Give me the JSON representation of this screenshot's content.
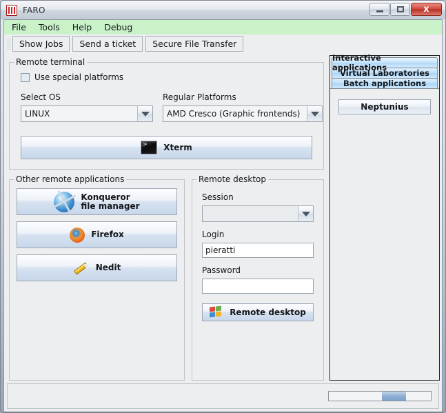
{
  "window": {
    "title": "FARO",
    "title_suffix": "",
    "icon": "faro-app-icon",
    "minimize_label": "",
    "maximize_label": "",
    "close_label": "x"
  },
  "menubar": {
    "items": [
      {
        "label": "File"
      },
      {
        "label": "Tools"
      },
      {
        "label": "Help"
      },
      {
        "label": "Debug"
      }
    ]
  },
  "toolbar": {
    "buttons": [
      {
        "label": "Show Jobs"
      },
      {
        "label": "Send a ticket"
      },
      {
        "label": "Secure File Transfer"
      }
    ]
  },
  "remote_terminal": {
    "title": "Remote terminal",
    "special_platforms": {
      "label": "Use special platforms",
      "checked": false
    },
    "select_os": {
      "label": "Select OS",
      "value": "LINUX"
    },
    "regular_platforms": {
      "label": "Regular Platforms",
      "value": "AMD Cresco (Graphic frontends)"
    },
    "xterm_button": {
      "label": "Xterm",
      "icon": "terminal-icon"
    }
  },
  "other_apps": {
    "title": "Other remote applications",
    "buttons": [
      {
        "label": "Konqueror\nfile manager",
        "line1": "Konqueror",
        "line2": "file manager",
        "icon": "konqueror-icon"
      },
      {
        "label": "Firefox",
        "line1": "Firefox",
        "line2": "",
        "icon": "firefox-icon"
      },
      {
        "label": "Nedit",
        "line1": "Nedit",
        "line2": "",
        "icon": "nedit-icon"
      }
    ]
  },
  "remote_desktop": {
    "title": "Remote desktop",
    "session": {
      "label": "Session",
      "value": ""
    },
    "login": {
      "label": "Login",
      "value": "pieratti"
    },
    "password": {
      "label": "Password",
      "value": ""
    },
    "button": {
      "label": "Remote desktop",
      "icon": "windows-icon"
    }
  },
  "sidebar": {
    "tabs": [
      {
        "label": "Interactive applications",
        "selected": true
      },
      {
        "label": "Virtual Laboratories",
        "selected": false
      },
      {
        "label": "Batch applications",
        "selected": false
      }
    ],
    "items": [
      {
        "label": "Neptunius"
      }
    ]
  },
  "statusbar": {
    "message": "",
    "progress": {
      "indeterminate": true,
      "position_percent": 52,
      "width_percent": 24
    }
  },
  "colors": {
    "menubar_bg": "#c9f2c9",
    "panel_bg": "#eceeef",
    "tab_bg": "#bfe0fa",
    "button_accent": "#c7d7ea",
    "close_button": "#d1473c"
  }
}
